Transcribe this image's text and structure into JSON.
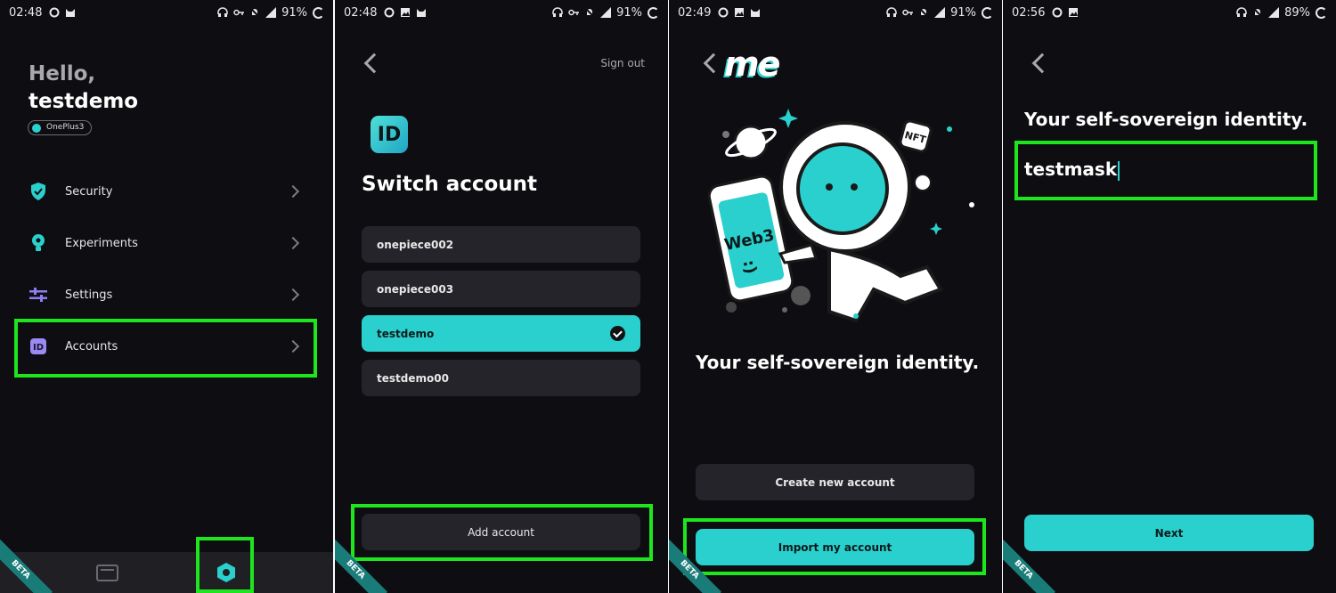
{
  "screens": [
    {
      "status": {
        "time": "02:48",
        "battery": "91%"
      },
      "greeting": "Hello,",
      "username": "testdemo",
      "device": "OnePlus3",
      "menu": [
        {
          "label": "Security",
          "icon": "shield-icon"
        },
        {
          "label": "Experiments",
          "icon": "bulb-icon"
        },
        {
          "label": "Settings",
          "icon": "sliders-icon"
        },
        {
          "label": "Accounts",
          "icon": "id-card-icon"
        }
      ],
      "beta": "BETA"
    },
    {
      "status": {
        "time": "02:48",
        "battery": "91%"
      },
      "sign_out": "Sign out",
      "logo_text": "ID",
      "title": "Switch account",
      "accounts": [
        {
          "name": "onepiece002",
          "selected": false
        },
        {
          "name": "onepiece003",
          "selected": false
        },
        {
          "name": "testdemo",
          "selected": true
        },
        {
          "name": "testdemo00",
          "selected": false
        }
      ],
      "add_account": "Add account",
      "beta": "BETA"
    },
    {
      "status": {
        "time": "02:49",
        "battery": "91%"
      },
      "logo": "me",
      "illustration_text": {
        "phone": "Web3",
        "face": ":)",
        "badge": "NFT"
      },
      "tagline": "Your self-sovereign identity.",
      "create_account": "Create new account",
      "import_account": "Import my account",
      "beta": "BETA"
    },
    {
      "status": {
        "time": "02:56",
        "battery": "89%"
      },
      "title": "Your self-sovereign identity.",
      "input_value": "testmask",
      "next": "Next",
      "beta": "BETA"
    }
  ],
  "colors": {
    "accent": "#2ad0cd",
    "highlight": "#1ee51e",
    "background": "#0e0e12"
  }
}
